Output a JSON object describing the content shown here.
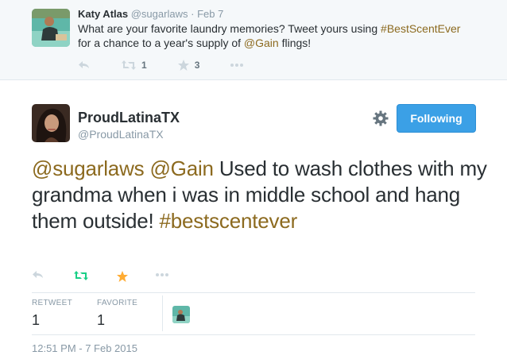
{
  "parent_tweet": {
    "name": "Katy Atlas",
    "handle": "@sugarlaws",
    "separator": "·",
    "time": "Feb 7",
    "text_1": "What are your favorite laundry memories?  Tweet yours using ",
    "hashtag": "#BestScentEver",
    "text_2": "for a chance to a year's supply of ",
    "mention": "@Gain",
    "text_3": " flings!",
    "retweet_count": "1",
    "favorite_count": "3",
    "icons": [
      "reply-icon",
      "retweet-icon",
      "star-icon",
      "more-icon"
    ]
  },
  "main_tweet": {
    "name": "ProudLatinaTX",
    "handle": "@ProudLatinaTX",
    "follow_label": "Following",
    "mention_1": "@sugarlaws",
    "mention_2": "@Gain",
    "body": " Used to wash clothes with my grandma when i was in middle school and hang them outside! ",
    "hashtag": "#bestscentever",
    "stats": {
      "retweet_label": "RETWEET",
      "retweet_value": "1",
      "favorite_label": "FAVORITE",
      "favorite_value": "1"
    },
    "timestamp": "12:51 PM - 7 Feb 2015",
    "icons": [
      "gear-icon",
      "reply-icon",
      "retweet-icon",
      "star-icon",
      "more-icon"
    ]
  },
  "colors": {
    "link": "#8c6a1f",
    "follow_button": "#3ba0e6",
    "retweet_active": "#19cf86",
    "favorite_active": "#ffac33",
    "muted": "#8899a6"
  }
}
